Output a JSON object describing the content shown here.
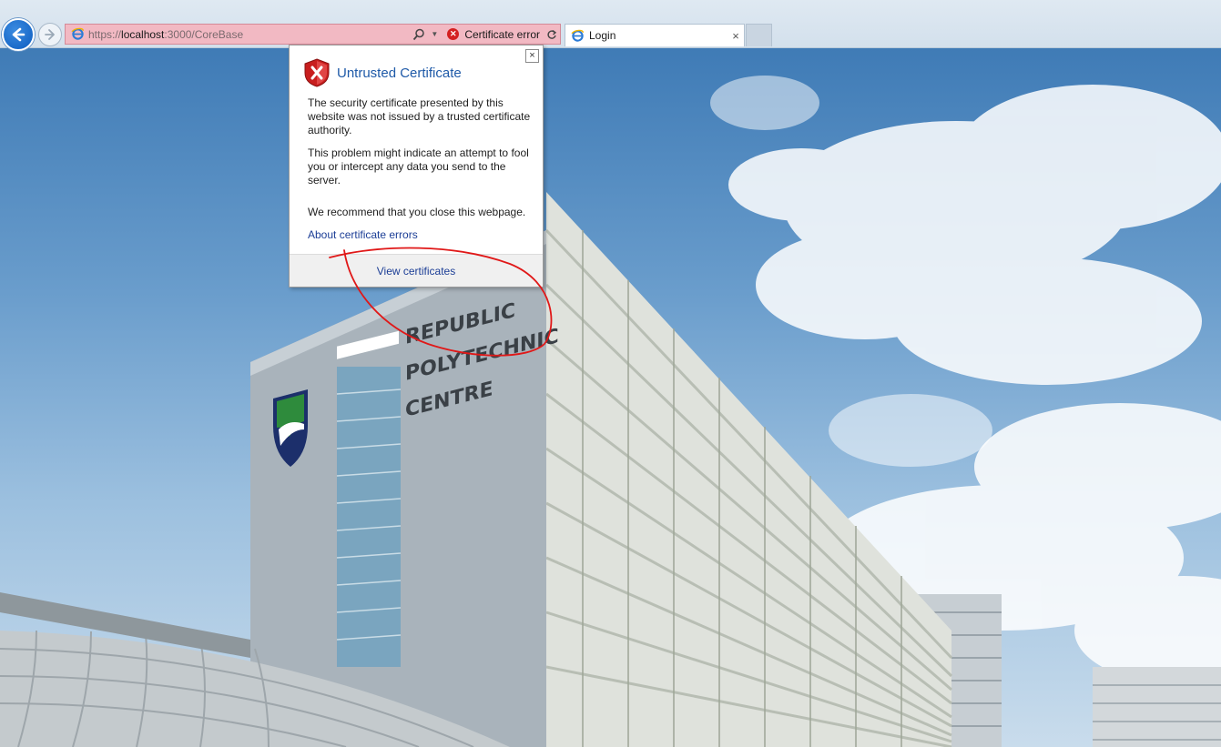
{
  "browser": {
    "address": {
      "scheme": "https://",
      "host": "localhost",
      "path": ":3000/CoreBase",
      "status_label": "Certificate error"
    },
    "tabs": [
      {
        "label": "Login",
        "close": "×"
      }
    ],
    "colors": {
      "address_error_bg": "#f2b9c3",
      "back_button": "#0b5cc0"
    }
  },
  "popup": {
    "title": "Untrusted Certificate",
    "paragraphs": [
      "The security certificate presented by this website was not issued by a trusted certificate authority.",
      "This problem might indicate an attempt to fool you or intercept any data you send to the server.",
      "We recommend that you close this webpage."
    ],
    "link_about": "About certificate errors",
    "view_certificates": "View certificates",
    "close": "×",
    "icon": "shield-error-icon"
  },
  "background": {
    "sign_lines": [
      "REPUBLIC",
      "POLYTECHNIC",
      "CENTRE"
    ]
  },
  "annotation": {
    "color": "#e01818"
  }
}
